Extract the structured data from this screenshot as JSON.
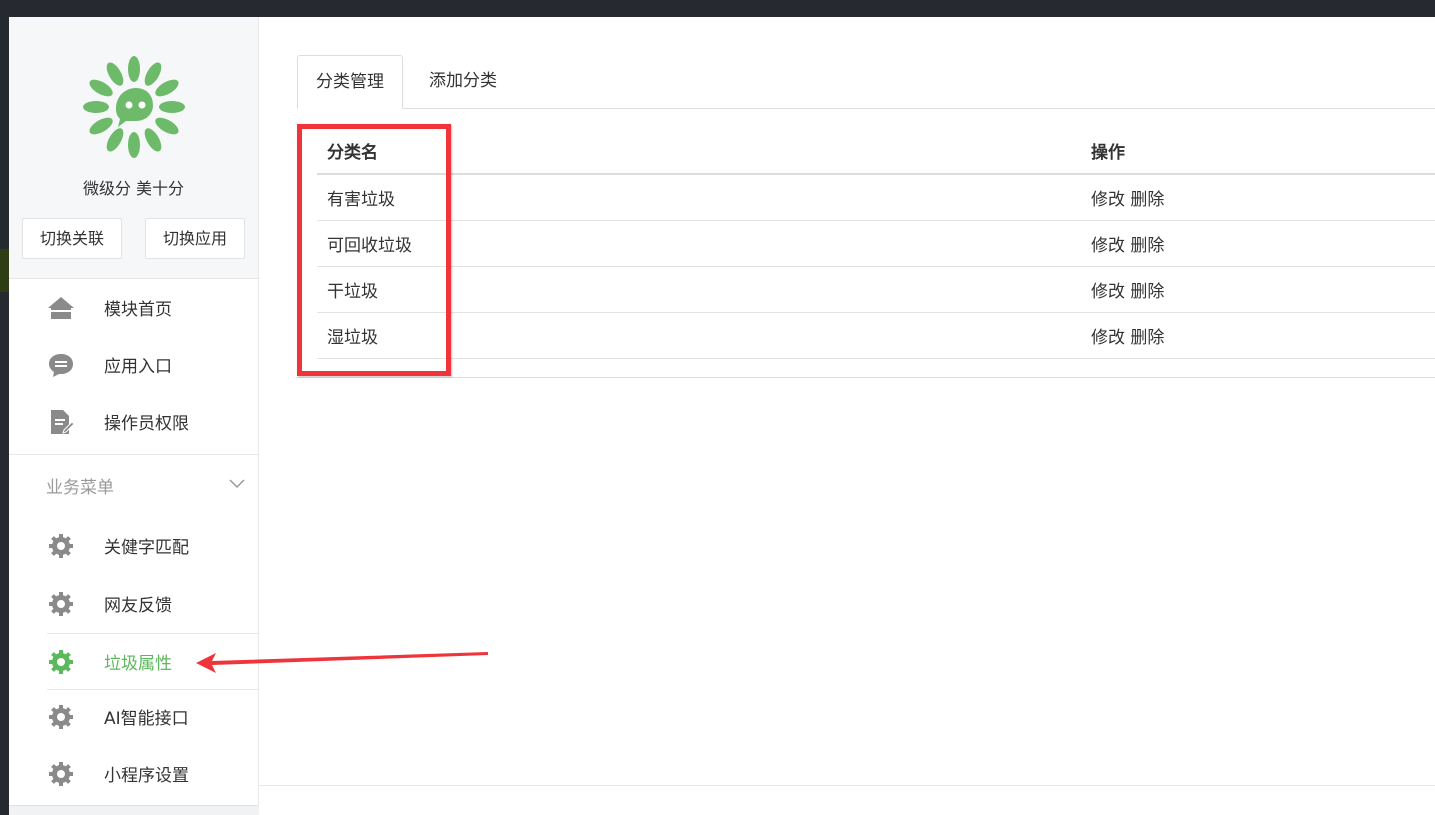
{
  "sidebar": {
    "brand": "微级分 美十分",
    "buttons": {
      "switch_link": "切换关联",
      "switch_app": "切换应用"
    },
    "items": [
      {
        "label": "模块首页",
        "icon": "home-icon"
      },
      {
        "label": "应用入口",
        "icon": "chat-bubble-icon"
      },
      {
        "label": "操作员权限",
        "icon": "document-edit-icon"
      }
    ],
    "group": {
      "title": "业务菜单",
      "items": [
        {
          "label": "关健字匹配",
          "icon": "gear-icon"
        },
        {
          "label": "网友反馈",
          "icon": "gear-icon"
        },
        {
          "label": "垃圾属性",
          "icon": "gear-icon",
          "active": true
        },
        {
          "label": "AI智能接口",
          "icon": "gear-icon"
        },
        {
          "label": "小程序设置",
          "icon": "gear-icon"
        }
      ]
    }
  },
  "main": {
    "tabs": [
      {
        "label": "分类管理",
        "active": true
      },
      {
        "label": "添加分类",
        "active": false
      }
    ],
    "table": {
      "headers": {
        "name": "分类名",
        "ops": "操作"
      },
      "rows": [
        {
          "name": "有害垃圾",
          "edit": "修改",
          "delete": "删除"
        },
        {
          "name": "可回收垃圾",
          "edit": "修改",
          "delete": "删除"
        },
        {
          "name": "干垃圾",
          "edit": "修改",
          "delete": "删除"
        },
        {
          "name": "湿垃圾",
          "edit": "修改",
          "delete": "删除"
        }
      ]
    }
  },
  "colors": {
    "accent_green": "#5cb85c",
    "annotation_red": "#f0343b",
    "icon_gray": "#8a8a8a"
  }
}
